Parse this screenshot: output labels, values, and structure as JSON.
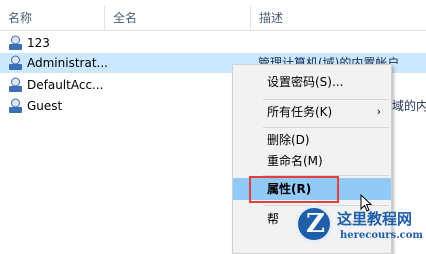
{
  "columns": [
    "名称",
    "全名",
    "描述"
  ],
  "users": [
    {
      "name": "123",
      "desc": "",
      "icon": "user-icon",
      "selected": false
    },
    {
      "name": "Administrat...",
      "desc": "管理计算机(域)的内置帐户",
      "icon": "user-icon",
      "selected": true
    },
    {
      "name": "DefaultAcc...",
      "desc": "",
      "icon": "user-icon",
      "selected": false
    },
    {
      "name": "Guest",
      "desc": "域的内",
      "icon": "user-icon",
      "selected": false
    }
  ],
  "context_menu": {
    "set_password": "设置密码(S)...",
    "all_tasks": "所有任务(K)",
    "all_tasks_arrow": "›",
    "delete": "删除(D)",
    "rename": "重命名(M)",
    "properties": "属性(R)",
    "help": "帮"
  },
  "watermark": {
    "badge": "Z",
    "title": "这里教程网",
    "url": "herecours.com"
  },
  "colors": {
    "selection": "#cce8ff",
    "menu_hover": "#91c9f7",
    "highlight_box": "#e43f3f",
    "logo_blue": "#1f5ea8"
  }
}
